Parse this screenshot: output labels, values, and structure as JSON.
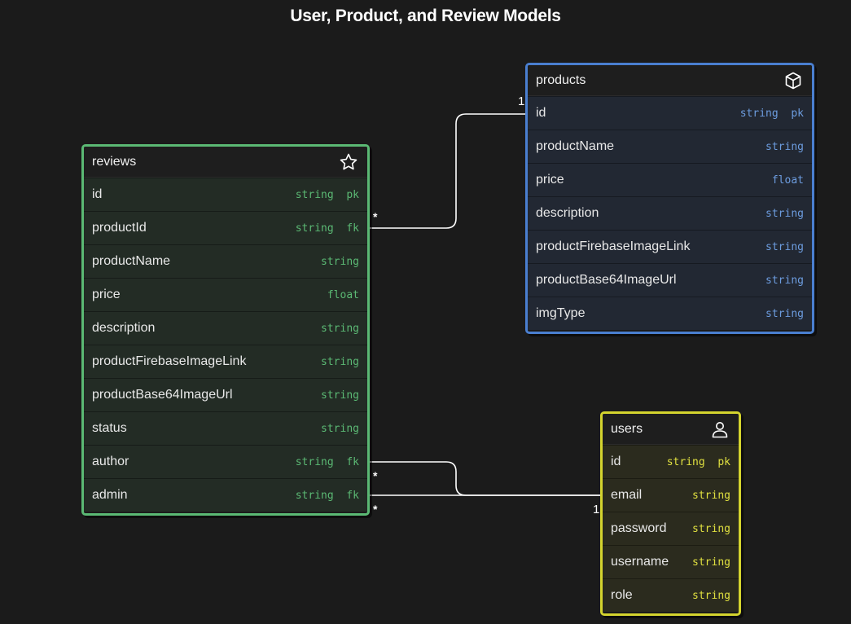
{
  "title": "User, Product, and Review Models",
  "colors": {
    "reviews": "#5bb974",
    "products": "#4a7fd0",
    "users": "#d4d42e",
    "background": "#1b1b1b"
  },
  "entities": {
    "reviews": {
      "name": "reviews",
      "icon": "star-icon",
      "fields": [
        {
          "name": "id",
          "type": "string  pk"
        },
        {
          "name": "productId",
          "type": "string  fk"
        },
        {
          "name": "productName",
          "type": "string"
        },
        {
          "name": "price",
          "type": "float"
        },
        {
          "name": "description",
          "type": "string"
        },
        {
          "name": "productFirebaseImageLink",
          "type": "string"
        },
        {
          "name": "productBase64ImageUrl",
          "type": "string"
        },
        {
          "name": "status",
          "type": "string"
        },
        {
          "name": "author",
          "type": "string  fk"
        },
        {
          "name": "admin",
          "type": "string  fk"
        }
      ]
    },
    "products": {
      "name": "products",
      "icon": "cube-icon",
      "fields": [
        {
          "name": "id",
          "type": "string  pk"
        },
        {
          "name": "productName",
          "type": "string"
        },
        {
          "name": "price",
          "type": "float"
        },
        {
          "name": "description",
          "type": "string"
        },
        {
          "name": "productFirebaseImageLink",
          "type": "string"
        },
        {
          "name": "productBase64ImageUrl",
          "type": "string"
        },
        {
          "name": "imgType",
          "type": "string"
        }
      ]
    },
    "users": {
      "name": "users",
      "icon": "user-icon",
      "fields": [
        {
          "name": "id",
          "type": "string  pk"
        },
        {
          "name": "email",
          "type": "string"
        },
        {
          "name": "password",
          "type": "string"
        },
        {
          "name": "username",
          "type": "string"
        },
        {
          "name": "role",
          "type": "string"
        }
      ]
    }
  },
  "relationships": {
    "productId_products": {
      "many": "*",
      "one": "1"
    },
    "author_users": {
      "many": "*",
      "one": "1"
    },
    "admin_users": {
      "many": "*",
      "one": "1"
    }
  }
}
